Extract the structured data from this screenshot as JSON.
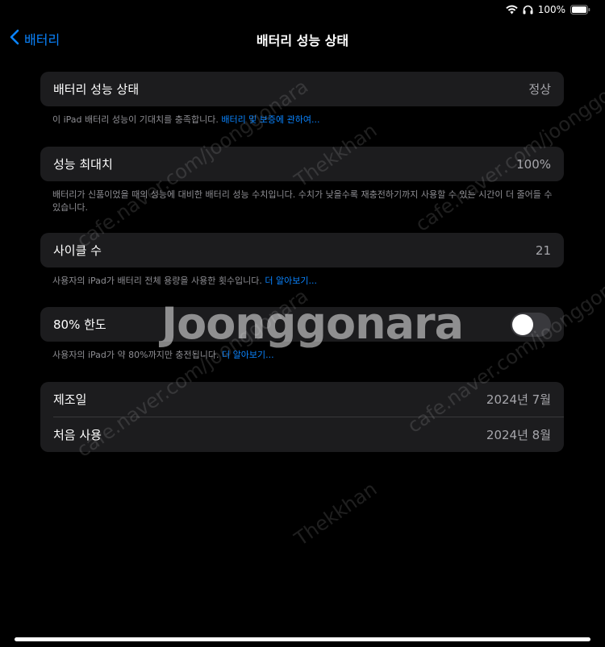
{
  "status_bar": {
    "battery_text": "100%"
  },
  "nav": {
    "back_label": "배터리",
    "title": "배터리 성능 상태"
  },
  "battery_health": {
    "label": "배터리 성능 상태",
    "value": "정상",
    "footnote": "이 iPad 배터리 성능이 기대치를 충족합니다.",
    "footnote_link": "배터리 및 보증에 관하여..."
  },
  "max_capacity": {
    "label": "성능 최대치",
    "value": "100%",
    "footnote": "배터리가 신품이었을 때의 성능에 대비한 배터리 성능 수치입니다. 수치가 낮을수록 재충전하기까지 사용할 수 있는 시간이 더 줄어들 수 있습니다."
  },
  "cycle_count": {
    "label": "사이클 수",
    "value": "21",
    "footnote": "사용자의 iPad가 배터리 전체 용량을 사용한 횟수입니다.",
    "footnote_link": "더 알아보기..."
  },
  "limit_80": {
    "label": "80% 한도",
    "toggle_on": false,
    "footnote": "사용자의 iPad가 약 80%까지만 충전됩니다.",
    "footnote_link": "더 알아보기..."
  },
  "manufacture": {
    "label": "제조일",
    "value": "2024년 7월"
  },
  "first_use": {
    "label": "처음 사용",
    "value": "2024년 8월"
  },
  "watermarks": {
    "main": "Joonggonara",
    "url": "cafe.naver.com/joonggonara",
    "user": "Thekkhan"
  },
  "colors": {
    "background": "#000000",
    "cell": "#1c1c1e",
    "accent": "#0a84ff",
    "secondary_text": "#8e8e93"
  },
  "icons": [
    "wifi-icon",
    "headphones-icon",
    "battery-icon",
    "chevron-left-icon"
  ]
}
